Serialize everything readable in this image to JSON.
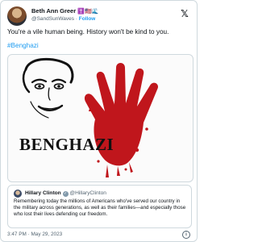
{
  "post": {
    "author": {
      "name": "Beth Ann Greer",
      "name_emojis": "✝️🇺🇸🌊",
      "handle": "@SandSunWaves",
      "separator": "·",
      "follow_label": "Follow"
    },
    "text": "You're a vile human being. History won't be kind to you.",
    "hashtag": "#Benghazi",
    "image_caption": "BENGHAZI",
    "timestamp": "3:47 PM · May 29, 2023"
  },
  "quoted": {
    "name": "Hillary Clinton",
    "handle": "@HillaryClinton",
    "text": "Remembering today the millions of Americans who've served our country in the military across generations, as well as their families—and especially those who lost their lives defending our freedom."
  },
  "icons": {
    "platform": "x-logo-icon",
    "info": "info-icon",
    "verified": "verified-badge-icon"
  },
  "colors": {
    "link": "#1d9bf0",
    "handprint": "#c0161c",
    "muted_text": "#536471",
    "border": "#cfd9de"
  }
}
